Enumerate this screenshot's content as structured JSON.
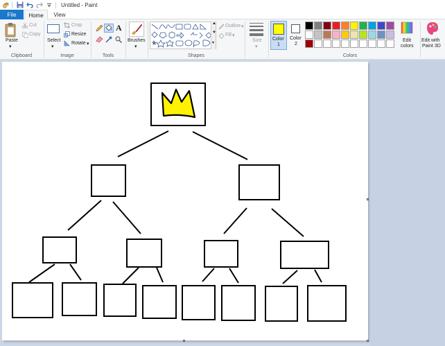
{
  "window": {
    "title": "Untitled - Paint"
  },
  "tabs": {
    "file": "File",
    "home": "Home",
    "view": "View"
  },
  "clipboard": {
    "paste": "Paste",
    "cut": "Cut",
    "copy": "Copy",
    "label": "Clipboard"
  },
  "image": {
    "select": "Select",
    "crop": "Crop",
    "resize": "Resize",
    "rotate": "Rotate",
    "label": "Image"
  },
  "tools": {
    "label": "Tools"
  },
  "brushes": {
    "label": "Brushes"
  },
  "shapes": {
    "outline": "Outline",
    "fill": "Fill",
    "label": "Shapes"
  },
  "size": {
    "label": "Size"
  },
  "colors": {
    "color1_label": "Color",
    "color1_num": "1",
    "color2_label": "Color",
    "color2_num": "2",
    "edit_line1": "Edit",
    "edit_line2": "colors",
    "label": "Colors",
    "color1_value": "#ffff00",
    "color2_value": "#ffffff",
    "palette_row1": [
      "#000000",
      "#7f7f7f",
      "#880015",
      "#ed1c24",
      "#ff7f27",
      "#fff200",
      "#22b14c",
      "#00a2e8",
      "#3f48cc",
      "#a349a4"
    ],
    "palette_row2": [
      "#ffffff",
      "#c3c3c3",
      "#b97a57",
      "#ffaec9",
      "#ffc90e",
      "#efe4b0",
      "#b5e61d",
      "#99d9ea",
      "#7092be",
      "#c8bfe7"
    ],
    "palette_row3": [
      "#a10000",
      "#ffffff",
      "#ffffff",
      "#ffffff",
      "#ffffff",
      "#ffffff",
      "#ffffff",
      "#ffffff",
      "#ffffff",
      "#ffffff"
    ]
  },
  "paint3d": {
    "line1": "Edit with",
    "line2": "Paint 3D"
  }
}
